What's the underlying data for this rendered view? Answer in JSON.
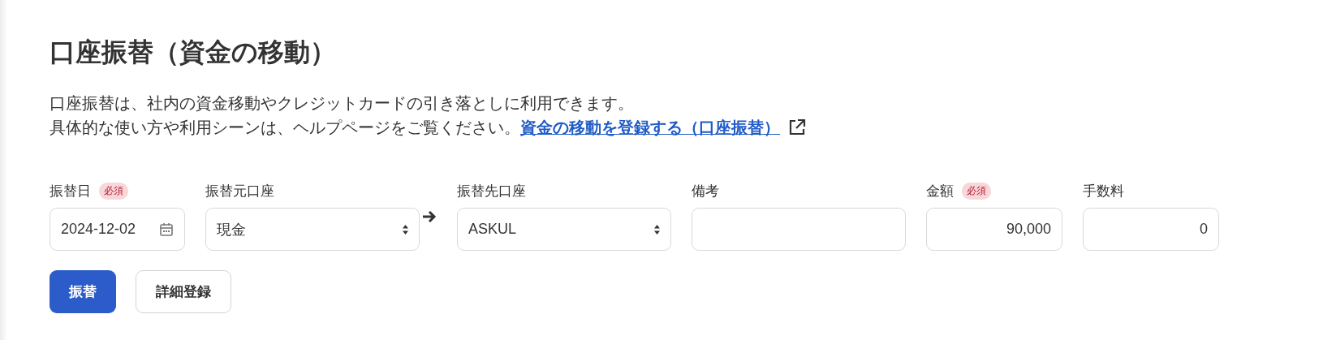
{
  "title": "口座振替（資金の移動）",
  "description": {
    "line_1": "口座振替は、社内の資金移動やクレジットカードの引き落としに利用できます。",
    "line_2": "具体的な使い方や利用シーンは、ヘルプページをご覧ください。",
    "link": "資金の移動を登録する（口座振替）"
  },
  "fields": [
    {
      "kind": "date",
      "label": "振替日",
      "badge": "必須",
      "value": "2024-12-02",
      "arrow_after": false
    },
    {
      "kind": "select",
      "label": "振替元口座",
      "value": "現金",
      "arrow_after": true
    },
    {
      "kind": "select",
      "label": "振替先口座",
      "value": "ASKUL",
      "arrow_after": false
    },
    {
      "kind": "text",
      "label": "備考",
      "arrow_after": false
    },
    {
      "kind": "number",
      "label": "金額",
      "badge": "必須",
      "value": "90,000",
      "arrow_after": false
    },
    {
      "kind": "number",
      "label": "手数料",
      "value": "0",
      "arrow_after": false
    }
  ],
  "buttons": [
    {
      "label": "振替",
      "kind": "primary"
    },
    {
      "label": "詳細登録",
      "kind": "secondary"
    }
  ]
}
